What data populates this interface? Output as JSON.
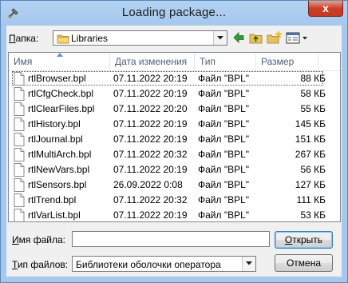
{
  "window": {
    "title": "Loading package...",
    "close_label": "x"
  },
  "toolbar": {
    "folder_label": "Папка:",
    "folder_label_ul": "П",
    "folder_label_rest": "апка:",
    "folder_value": "Libraries"
  },
  "columns": [
    "Имя",
    "Дата изменения",
    "Тип",
    "Размер"
  ],
  "files": [
    {
      "name": "rtlBrowser.bpl",
      "date": "07.11.2022 20:19",
      "type": "Файл \"BPL\"",
      "size": "88 КБ"
    },
    {
      "name": "rtlCfgCheck.bpl",
      "date": "07.11.2022 20:19",
      "type": "Файл \"BPL\"",
      "size": "58 КБ"
    },
    {
      "name": "rtlClearFiles.bpl",
      "date": "07.11.2022 20:20",
      "type": "Файл \"BPL\"",
      "size": "55 КБ"
    },
    {
      "name": "rtlHistory.bpl",
      "date": "07.11.2022 20:19",
      "type": "Файл \"BPL\"",
      "size": "145 КБ"
    },
    {
      "name": "rtlJournal.bpl",
      "date": "07.11.2022 20:19",
      "type": "Файл \"BPL\"",
      "size": "151 КБ"
    },
    {
      "name": "rtlMultiArch.bpl",
      "date": "07.11.2022 20:32",
      "type": "Файл \"BPL\"",
      "size": "267 КБ"
    },
    {
      "name": "rtlNewVars.bpl",
      "date": "07.11.2022 20:19",
      "type": "Файл \"BPL\"",
      "size": "56 КБ"
    },
    {
      "name": "rtlSensors.bpl",
      "date": "26.09.2022 0:08",
      "type": "Файл \"BPL\"",
      "size": "127 КБ"
    },
    {
      "name": "rtlTrend.bpl",
      "date": "07.11.2022 20:32",
      "type": "Файл \"BPL\"",
      "size": "111 КБ"
    },
    {
      "name": "rtlVarList.bpl",
      "date": "07.11.2022 20:19",
      "type": "Файл \"BPL\"",
      "size": "53 КБ"
    }
  ],
  "form": {
    "filename_label_ul": "И",
    "filename_label_rest": "мя файла:",
    "filename_value": "",
    "filetype_label_ul": "Т",
    "filetype_label_rest": "ип файлов:",
    "filetype_value": "Библиотеки оболочки оператора",
    "open_label_ul": "О",
    "open_label_rest": "ткрыть",
    "cancel_label": "Отмена"
  }
}
